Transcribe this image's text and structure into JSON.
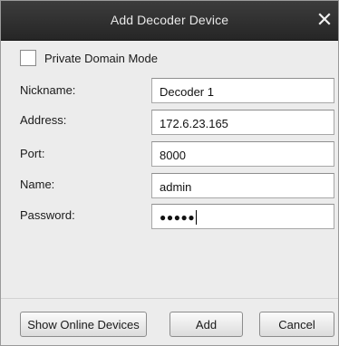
{
  "dialog": {
    "title": "Add Decoder Device"
  },
  "private_domain": {
    "label": "Private Domain Mode",
    "checked": false
  },
  "fields": {
    "nickname": {
      "label": "Nickname:",
      "value": "Decoder 1"
    },
    "address": {
      "label": "Address:",
      "value": "172.6.23.165"
    },
    "port": {
      "label": "Port:",
      "value": "8000"
    },
    "name": {
      "label": "Name:",
      "value": "admin"
    },
    "password": {
      "label": "Password:",
      "masked_value": "●●●●●"
    }
  },
  "buttons": {
    "show_online_devices": "Show Online Devices",
    "add": "Add",
    "cancel": "Cancel"
  },
  "icons": {
    "close": "close-icon",
    "checkbox": "checkbox-unchecked"
  },
  "colors": {
    "titlebar": "#2e2e2e",
    "dialog_bg": "#ececec"
  }
}
